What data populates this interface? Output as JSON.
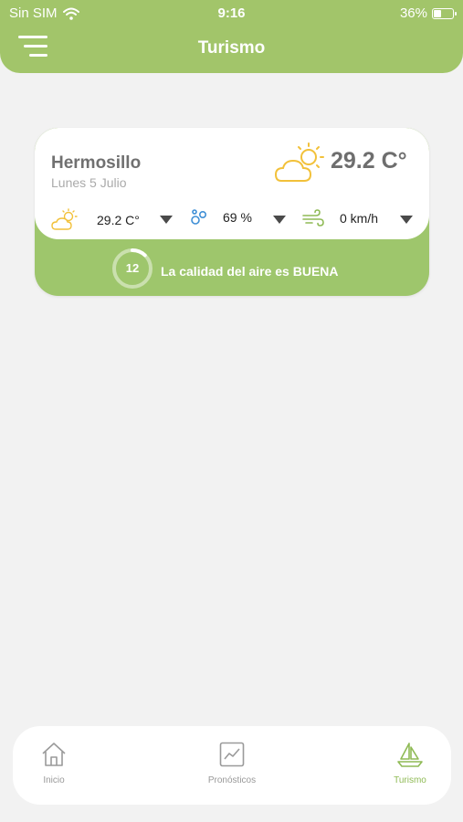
{
  "status_bar": {
    "carrier": "Sin SIM",
    "time": "9:16",
    "battery": "36%"
  },
  "header": {
    "title": "Turismo",
    "color": "#a2c56a"
  },
  "weather": {
    "city": "Hermosillo",
    "date": "Lunes 5 Julio",
    "temperature": "29.2 C°",
    "icon": "partly-cloudy-icon",
    "metrics": {
      "temperature": "29.2 C°",
      "humidity": "69 %",
      "wind": "0 km/h"
    },
    "air_quality": {
      "index": "12",
      "message": "La calidad del aire es BUENA",
      "level_fraction": 0.12,
      "color": "#9ec66c"
    }
  },
  "bottom_nav": {
    "items": [
      {
        "label": "Inicio",
        "icon": "home-icon"
      },
      {
        "label": "Pronósticos",
        "icon": "chart-icon"
      },
      {
        "label": "Turismo",
        "icon": "sailboat-icon",
        "active": true
      }
    ],
    "active_color": "#8fba55"
  }
}
